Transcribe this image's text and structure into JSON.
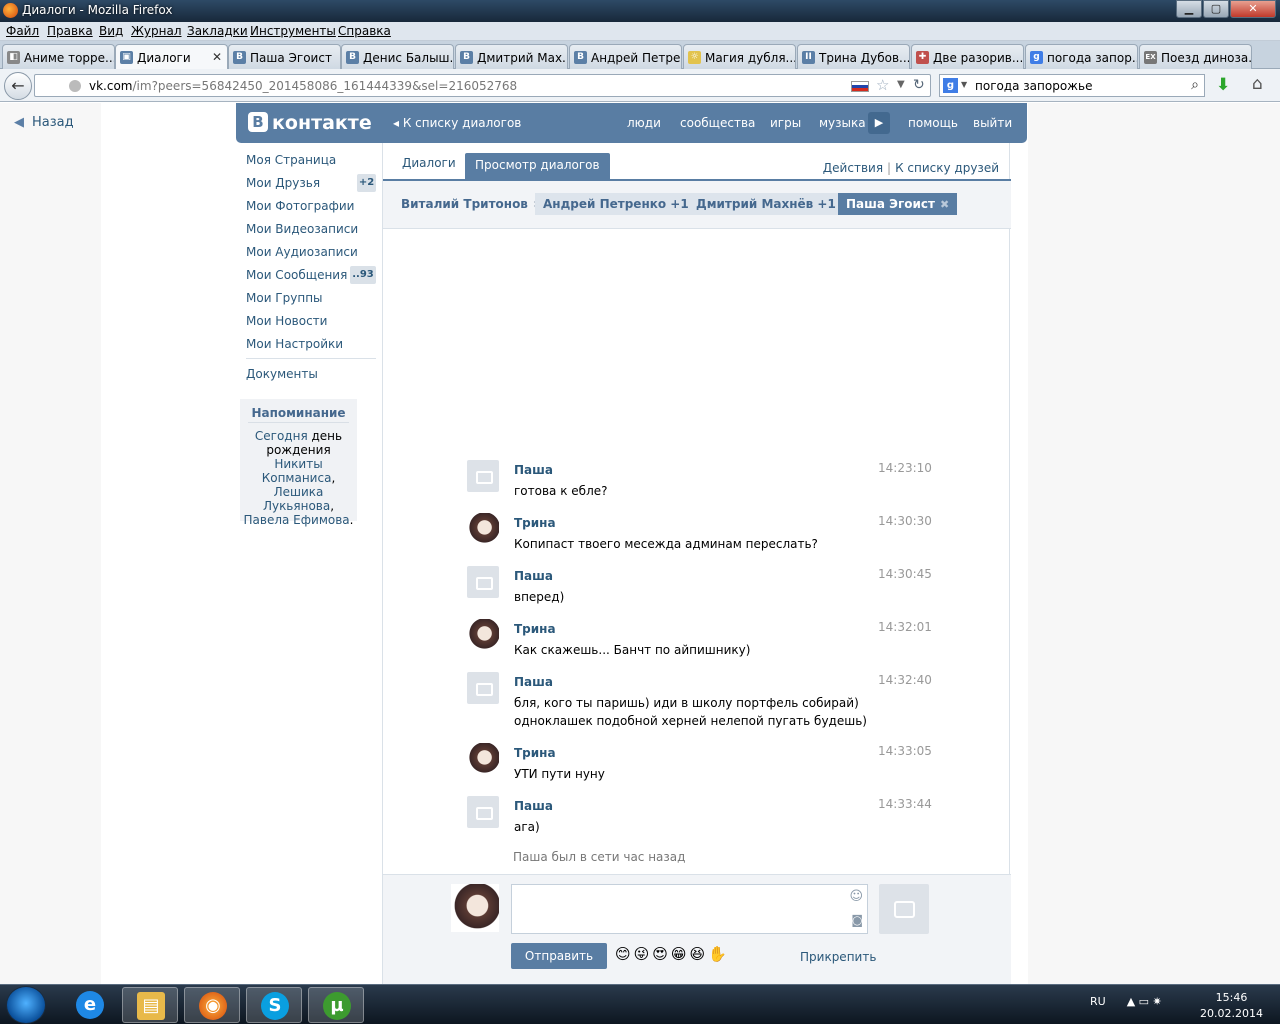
{
  "window": {
    "title": "Диалоги - Mozilla Firefox",
    "minimize": "▁",
    "maximize": "▢",
    "close": "✕"
  },
  "menu": [
    "Файл",
    "Правка",
    "Вид",
    "Журнал",
    "Закладки",
    "Инструменты",
    "Справка"
  ],
  "tabs": [
    {
      "label": "Аниме торре...",
      "icon": "◧"
    },
    {
      "label": "Диалоги",
      "icon": "▣",
      "active": true,
      "close": "✕"
    },
    {
      "label": "Паша Эгоист",
      "icon": "B"
    },
    {
      "label": "Денис Балыш...",
      "icon": "B"
    },
    {
      "label": "Дмитрий Мах...",
      "icon": "B"
    },
    {
      "label": "Андрей Петре...",
      "icon": "B"
    },
    {
      "label": "Магия дубля...",
      "icon": "☼"
    },
    {
      "label": "Трина Дубов...",
      "icon": "II"
    },
    {
      "label": "Две разорив...",
      "icon": "✚"
    },
    {
      "label": "погода запор...",
      "icon": "g"
    },
    {
      "label": "Поезд диноза...",
      "icon": "EX"
    }
  ],
  "new_tab": "+",
  "nav": {
    "back": "←",
    "url_domain": "vk.com",
    "url_rest": "/im?peers=56842450_201458086_161444339&sel=216052768",
    "star": "☆",
    "dropdown": "▼",
    "reload": "↻",
    "search_engine": "g",
    "search_arrow": "▼",
    "search_query": "погода запорожье",
    "search_icon": "⌕",
    "download_icon": "⬇",
    "home_icon": "⌂"
  },
  "page": {
    "back_link": "Назад",
    "back_arrow": "◀"
  },
  "vk": {
    "logo_b": "B",
    "logo_text": "контакте",
    "back_to_list": "◂ К списку диалогов",
    "nav": [
      "люди",
      "сообщества",
      "игры",
      "музыка",
      "помощь",
      "выйти"
    ],
    "play": "▶"
  },
  "sidebar": {
    "items": [
      {
        "label": "Моя Страница"
      },
      {
        "label": "Мои Друзья",
        "badge": "+2"
      },
      {
        "label": "Мои Фотографии"
      },
      {
        "label": "Мои Видеозаписи"
      },
      {
        "label": "Мои Аудиозаписи"
      },
      {
        "label": "Мои Сообщения",
        "badge": "..93"
      },
      {
        "label": "Мои Группы"
      },
      {
        "label": "Мои Новости"
      },
      {
        "label": "Мои Настройки"
      }
    ],
    "documents": "Документы",
    "reminder_title": "Напоминание",
    "reminder_w1": "Сегодня",
    "reminder_w2": " день рождения ",
    "reminder_w3": "Никиты Копманиса",
    "reminder_w4": ", ",
    "reminder_w5": "Лешика Лукьянова",
    "reminder_w6": ", ",
    "reminder_w7": "Павела Ефимова",
    "reminder_w8": "."
  },
  "dialog": {
    "tab_dialogs": "Диалоги",
    "tab_view": "Просмотр диалогов",
    "actions": "Действия",
    "separator": "|",
    "to_friends": "К списку друзей",
    "peers": [
      {
        "name": "Виталий Тритонов",
        "x": "✖"
      },
      {
        "name": "Андрей Петренко +1",
        "x": "✖"
      },
      {
        "name": "Дмитрий Махнёв +1",
        "x": "✖"
      },
      {
        "name": "Паша Эгоист",
        "x": "✖"
      }
    ],
    "messages": [
      {
        "author": "Паша",
        "time": "14:23:10",
        "text": "готова к ебле?"
      },
      {
        "author": "Трина",
        "time": "14:30:30",
        "text": "Копипаст твоего месежда админам переслать?"
      },
      {
        "author": "Паша",
        "time": "14:30:45",
        "text": "вперед)"
      },
      {
        "author": "Трина",
        "time": "14:32:01",
        "text": "Как скажешь... Банчт по айпишнику)"
      },
      {
        "author": "Паша",
        "time": "14:32:40",
        "text": "бля, кого ты паришь) иди в школу портфель собирай)",
        "text2": "одноклашек подобной херней нелепой пугать будешь)"
      },
      {
        "author": "Трина",
        "time": "14:33:05",
        "text": "УТИ пути нуну"
      },
      {
        "author": "Паша",
        "time": "14:33:44",
        "text": "ага)"
      }
    ],
    "status": "Паша был в сети час назад",
    "smiley": "☺",
    "photo_small": "◙",
    "send": "Отправить",
    "emojis": "😊😜😍😁😆✋",
    "attach": "Прикрепить"
  },
  "taskbar": {
    "apps": [
      {
        "name": "ie",
        "glyph": "e",
        "color": "#1e88e5"
      },
      {
        "name": "explorer",
        "glyph": "▤",
        "color": "#e8b94a"
      },
      {
        "name": "firefox",
        "glyph": "◉",
        "color": "#e06a1a"
      },
      {
        "name": "skype",
        "glyph": "S",
        "color": "#0a9fe0"
      },
      {
        "name": "utorrent",
        "glyph": "µ",
        "color": "#3d9b2f"
      }
    ],
    "lang": "RU",
    "tray": "▲  ▭  ✷",
    "time": "15:46",
    "date": "20.02.2014"
  }
}
